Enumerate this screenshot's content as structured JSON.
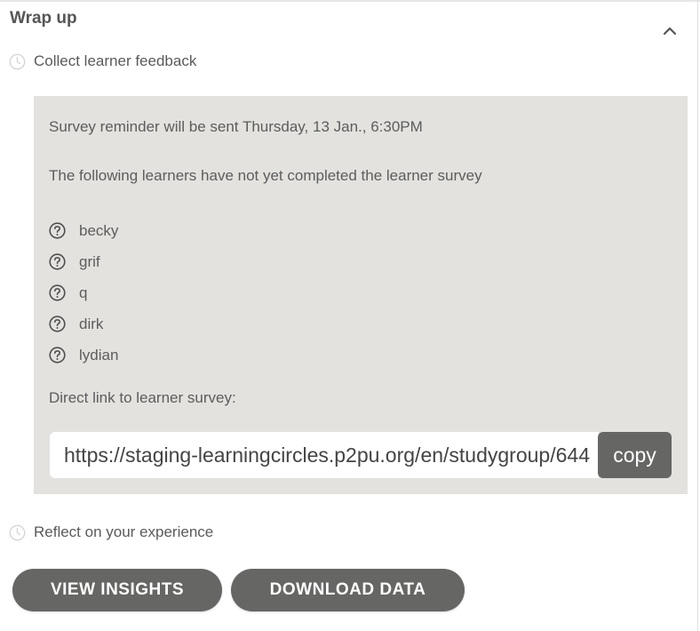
{
  "section": {
    "title": "Wrap up"
  },
  "steps": {
    "collect_feedback": "Collect learner feedback",
    "reflect": "Reflect on your experience"
  },
  "feedback_panel": {
    "reminder_text": "Survey reminder will be sent Thursday, 13 Jan., 6:30PM",
    "pending_intro": "The following learners have not yet completed the learner survey",
    "learners": [
      "becky",
      "grif",
      "q",
      "dirk",
      "lydian"
    ],
    "link_label": "Direct link to learner survey:",
    "survey_link": "https://staging-learningcircles.p2pu.org/en/studygroup/644",
    "copy_label": "copy"
  },
  "actions": {
    "view_insights": "VIEW INSIGHTS",
    "download_data": "DOWNLOAD DATA"
  },
  "icons": {
    "collapse": "chevron-up-icon",
    "step_status": "clock-icon",
    "learner_status": "question-circle-icon"
  },
  "colors": {
    "panel_bg": "#e3e2df",
    "button_bg": "#666664",
    "text": "#5b5b5b"
  }
}
